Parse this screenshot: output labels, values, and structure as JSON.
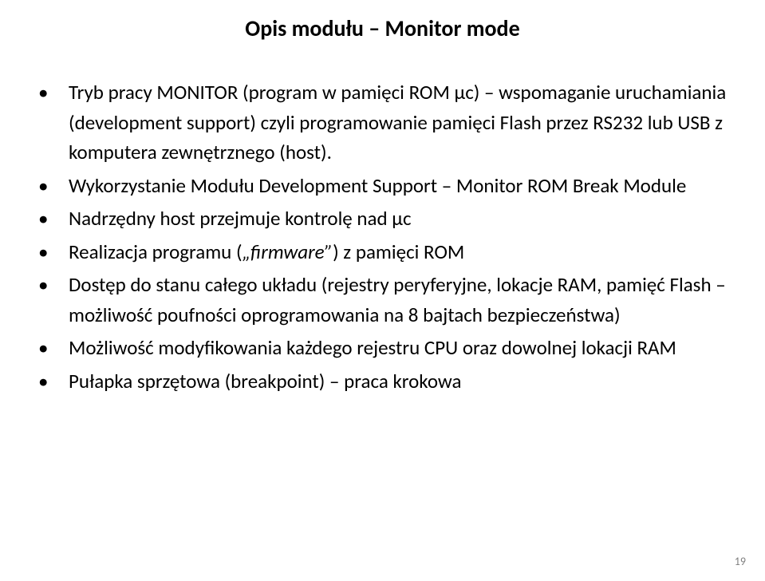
{
  "title": "Opis modułu – Monitor mode",
  "bullets": [
    "Tryb pracy MONITOR (program w pamięci ROM μc) – wspomaganie uruchamiania (development support) czyli programowanie pamięci Flash przez RS232 lub USB z komputera zewnętrznego (host).",
    "Wykorzystanie Modułu Development Support – Monitor ROM Break Module",
    "Nadrzędny host przejmuje kontrolę nad μc",
    "",
    "Dostęp do stanu całego układu (rejestry peryferyjne, lokacje RAM, pamięć Flash – możliwość poufności oprogramowania na 8 bajtach bezpieczeństwa)",
    "Możliwość modyfikowania każdego rejestru CPU oraz dowolnej lokacji RAM",
    "Pułapka sprzętowa  (breakpoint) – praca krokowa"
  ],
  "bullet_firmware": {
    "pre": "Realizacja programu (",
    "italic": "„firmware”",
    "post": ") z pamięci ROM"
  },
  "page_number": "19"
}
